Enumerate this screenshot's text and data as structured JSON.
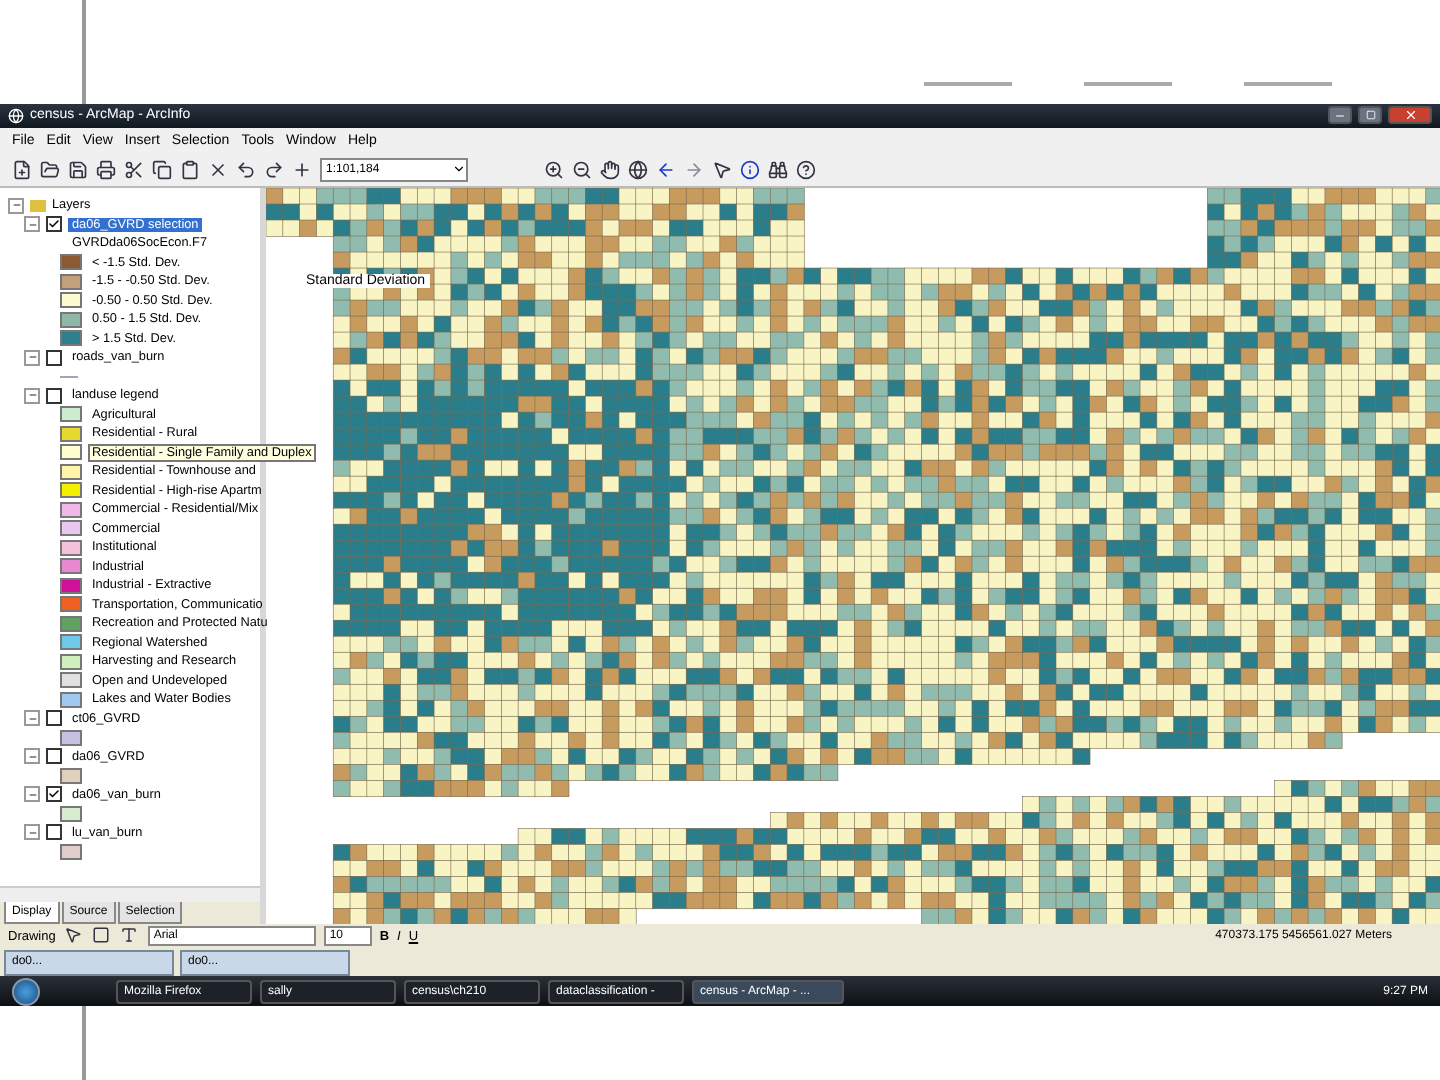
{
  "window": {
    "title": "census - ArcMap - ArcInfo"
  },
  "menu": [
    "File",
    "Edit",
    "View",
    "Insert",
    "Selection",
    "Tools",
    "Window",
    "Help"
  ],
  "toolbar": {
    "scale": "1:101,184"
  },
  "toc": {
    "root": "Layers",
    "layers": [
      {
        "name": "da06_GVRD selection",
        "checked": true,
        "expanded": true,
        "selected": true,
        "field": "GVRDda06SocEcon.F7",
        "legend": [
          {
            "label": "< -1.5 Std. Dev.",
            "color": "#8c5a32",
            "hovered": false
          },
          {
            "label": "-1.5 - -0.50 Std. Dev.",
            "color": "#c4a07a",
            "hovered": false
          },
          {
            "label": "-0.50 - 0.50 Std. Dev.",
            "color": "#fdfbd0",
            "hovered": false
          },
          {
            "label": "0.50 - 1.5 Std. Dev.",
            "color": "#8fb8a8",
            "hovered": false
          },
          {
            "label": "> 1.5 Std. Dev.",
            "color": "#2e7f8c",
            "hovered": false
          }
        ]
      },
      {
        "name": "roads_van_burn",
        "checked": false,
        "expanded": true,
        "selected": false,
        "legend": [
          {
            "kind": "line",
            "color": "#a0a0c8"
          }
        ]
      },
      {
        "name": "landuse legend",
        "checked": false,
        "expanded": true,
        "selected": false,
        "legend": [
          {
            "label": "Agricultural",
            "color": "#cdeccd",
            "hovered": false
          },
          {
            "label": "Residential - Rural",
            "color": "#e6d830",
            "hovered": false
          },
          {
            "label": "Residential - Single Family and Duplex",
            "color": "#fffcd0",
            "hovered": true
          },
          {
            "label": "Residential - Townhouse and",
            "color": "#fff6a8",
            "hovered": false
          },
          {
            "label": "Residential - High-rise Apartm",
            "color": "#f5f000",
            "hovered": false
          },
          {
            "label": "Commercial - Residential/Mix",
            "color": "#f0b8e8",
            "hovered": false
          },
          {
            "label": "Commercial",
            "color": "#e8c8f0",
            "hovered": false
          },
          {
            "label": "Institutional",
            "color": "#f4c0dc",
            "hovered": false
          },
          {
            "label": "Industrial",
            "color": "#e888d0",
            "hovered": false
          },
          {
            "label": "Industrial - Extractive",
            "color": "#d0109a",
            "hovered": false
          },
          {
            "label": "Transportation, Communicatio",
            "color": "#f06020",
            "hovered": false
          },
          {
            "label": "Recreation and Protected Natu",
            "color": "#60a060",
            "hovered": false
          },
          {
            "label": "Regional Watershed",
            "color": "#70c8e8",
            "hovered": false
          },
          {
            "label": "Harvesting and Research",
            "color": "#d0f0c0",
            "hovered": false
          },
          {
            "label": "Open and Undeveloped",
            "color": "#e0e0e0",
            "hovered": false
          },
          {
            "label": "Lakes and Water Bodies",
            "color": "#a0c8f0",
            "hovered": false
          }
        ]
      },
      {
        "name": "ct06_GVRD",
        "checked": false,
        "expanded": true,
        "selected": false,
        "legend": [
          {
            "kind": "fill",
            "color": "#c8c0e0"
          }
        ]
      },
      {
        "name": "da06_GVRD",
        "checked": false,
        "expanded": true,
        "selected": false,
        "legend": [
          {
            "kind": "fill",
            "color": "#e0d0c0"
          }
        ]
      },
      {
        "name": "da06_van_burn",
        "checked": true,
        "expanded": true,
        "selected": false,
        "legend": [
          {
            "kind": "fill",
            "color": "#d8ecd0"
          }
        ]
      },
      {
        "name": "lu_van_burn",
        "checked": false,
        "expanded": true,
        "selected": false,
        "legend": [
          {
            "kind": "fill",
            "color": "#e0ccc8"
          }
        ]
      }
    ],
    "tabs": [
      {
        "label": "Display",
        "selected": true
      },
      {
        "label": "Source",
        "selected": false
      },
      {
        "label": "Selection",
        "selected": false
      }
    ]
  },
  "map": {
    "label": "Standard Deviation"
  },
  "drawing_toolbar": {
    "menu": "Drawing",
    "font": "Arial",
    "size": "10",
    "bold": "B",
    "italic": "I",
    "underline": "U"
  },
  "status_bar": {
    "coordinates": "470373.175  5456561.027 Meters"
  },
  "minimized": [
    {
      "label": "do0..."
    },
    {
      "label": "do0..."
    }
  ],
  "taskbar": {
    "items": [
      {
        "label": "Mozilla Firefox",
        "selected": false
      },
      {
        "label": "sally",
        "selected": false
      },
      {
        "label": "census\\ch210",
        "selected": false
      },
      {
        "label": "dataclassification -",
        "selected": false
      },
      {
        "label": "census - ArcMap - ...",
        "selected": true
      }
    ],
    "clock": "9:27 PM"
  }
}
